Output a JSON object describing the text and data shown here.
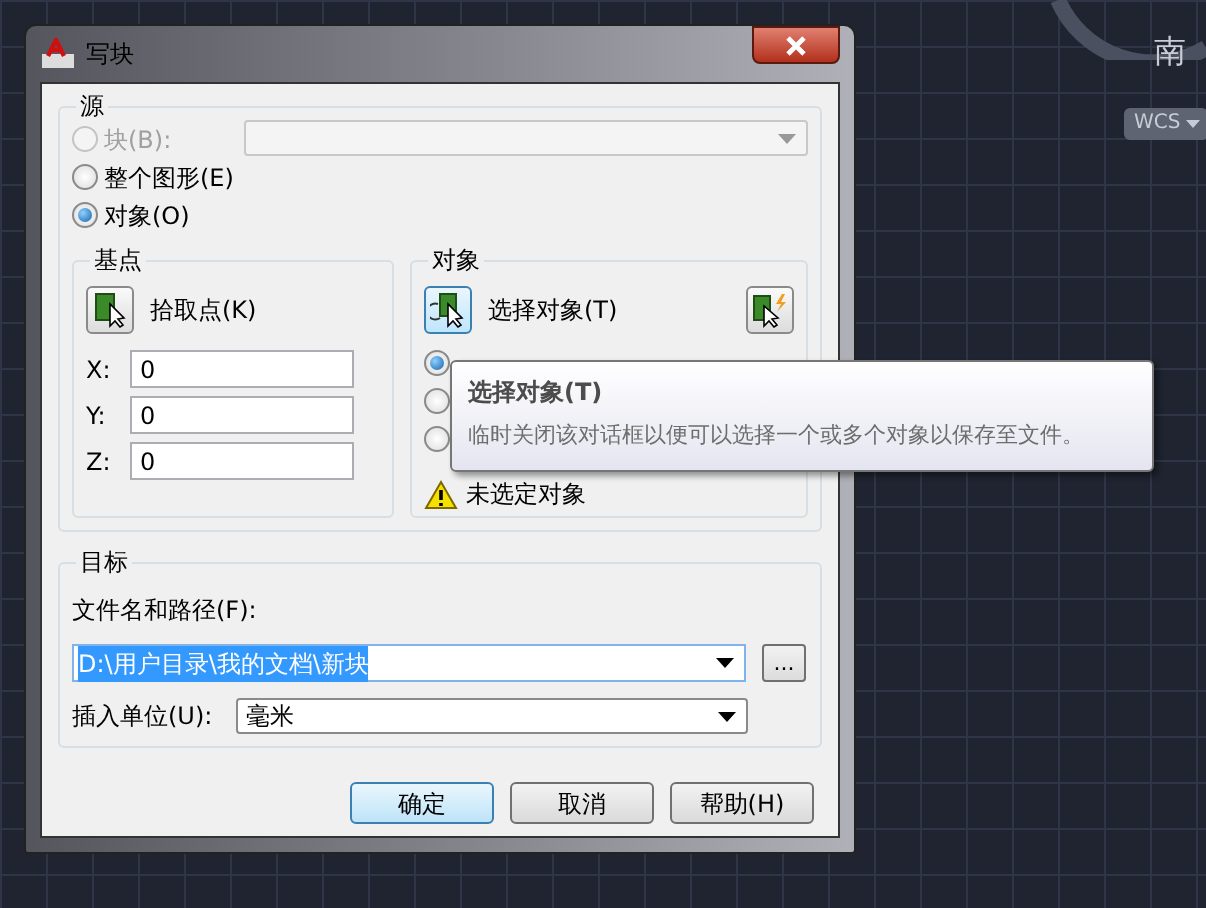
{
  "window": {
    "title": "写块"
  },
  "source": {
    "legend": "源",
    "options": [
      {
        "label": "块(B):",
        "selected": false,
        "disabled": true
      },
      {
        "label": "整个图形(E)",
        "selected": false,
        "disabled": false
      },
      {
        "label": "对象(O)",
        "selected": true,
        "disabled": false
      }
    ],
    "block_select": {
      "disabled": true
    }
  },
  "base_point": {
    "legend": "基点",
    "pick_button": "拾取点(K)",
    "coords": [
      {
        "label": "X:",
        "value": "0"
      },
      {
        "label": "Y:",
        "value": "0"
      },
      {
        "label": "Z:",
        "value": "0"
      }
    ]
  },
  "objects": {
    "legend": "对象",
    "select_button": "选择对象(T)",
    "retain_options": [
      {
        "selected": true
      },
      {
        "selected": false
      },
      {
        "selected": false
      }
    ],
    "warning": "未选定对象"
  },
  "tooltip": {
    "title": "选择对象(T)",
    "text": "临时关闭该对话框以便可以选择一个或多个对象以保存至文件。"
  },
  "target": {
    "legend": "目标",
    "file_label": "文件名和路径(F):",
    "file_path": "D:\\用户目录\\我的文档\\新块",
    "browse": "...",
    "units_label": "插入单位(U):",
    "units": "毫米"
  },
  "buttons": [
    {
      "label": "确定",
      "default": true
    },
    {
      "label": "取消",
      "default": false
    },
    {
      "label": "帮助(H)",
      "default": false
    }
  ],
  "viewcube": {
    "direction": "南",
    "wcs": "WCS"
  }
}
